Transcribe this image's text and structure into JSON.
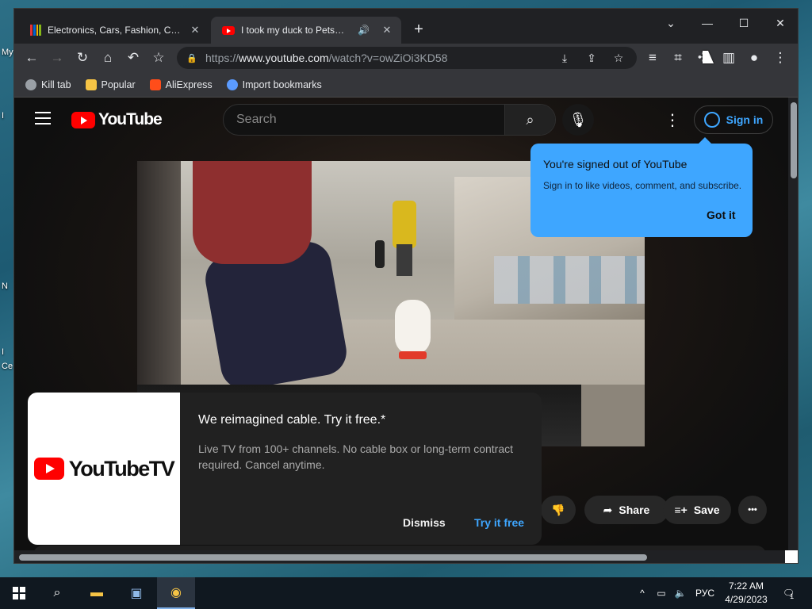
{
  "desktop": {
    "labels": [
      "My",
      "I",
      "N",
      "I",
      "Ce"
    ]
  },
  "browser": {
    "tabs": [
      {
        "title": "Electronics, Cars, Fashion, Collect",
        "favicon": "ebay-icon",
        "active": false
      },
      {
        "title": "I took my duck to Petsmart -",
        "favicon": "youtube-icon",
        "active": true,
        "audio": "speaker-icon"
      }
    ],
    "new_tab_label": "+",
    "window_controls": {
      "tab_search": "⌄",
      "minimize": "—",
      "maximize": "☐",
      "close": "✕"
    },
    "address_bar": {
      "scheme": "https://",
      "host": "www.youtube.com",
      "path": "/watch?v=owZiOi3KD58"
    },
    "bookmarks": [
      {
        "label": "Kill tab",
        "icon": "globe-icon",
        "color": "#9aa0a6"
      },
      {
        "label": "Popular",
        "icon": "folder-icon",
        "color": "#f6c445"
      },
      {
        "label": "AliExpress",
        "icon": "aliexpress-icon",
        "color": "#ff4d1a"
      },
      {
        "label": "Import bookmarks",
        "icon": "gear-icon",
        "color": "#5b9bff"
      }
    ]
  },
  "youtube": {
    "logo_text": "YouTube",
    "search_placeholder": "Search",
    "sign_in_label": "Sign in",
    "tooltip": {
      "title": "You're signed out of YouTube",
      "body": "Sign in to like videos, comment, and subscribe.",
      "button": "Got it"
    },
    "actions": {
      "share": "Share",
      "save": "Save",
      "more": "•••"
    },
    "promo": {
      "logo_text": "YouTubeTV",
      "title": "We reimagined cable. Try it free.*",
      "body": "Live TV from 100+ channels. No cable box or long-term contract required. Cancel anytime.",
      "dismiss": "Dismiss",
      "try": "Try it free"
    }
  },
  "taskbar": {
    "language": "РУС",
    "time": "7:22 AM",
    "date": "4/29/2023",
    "notification_count": "1"
  },
  "colors": {
    "accent_blue": "#3ea6ff",
    "youtube_red": "#ff0000",
    "chrome_dark": "#202124"
  }
}
